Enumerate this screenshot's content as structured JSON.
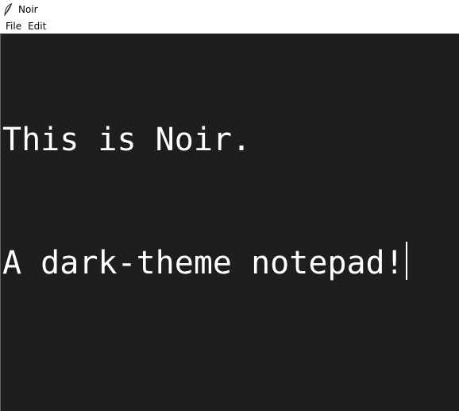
{
  "window": {
    "title": "Noir",
    "icon": "feather-icon"
  },
  "menubar": {
    "items": [
      {
        "label": "File"
      },
      {
        "label": "Edit"
      }
    ]
  },
  "editor": {
    "lines": [
      "This is Noir.",
      "A dark-theme notepad!"
    ],
    "background_color": "#1e1e1e",
    "text_color": "#ffffff"
  }
}
